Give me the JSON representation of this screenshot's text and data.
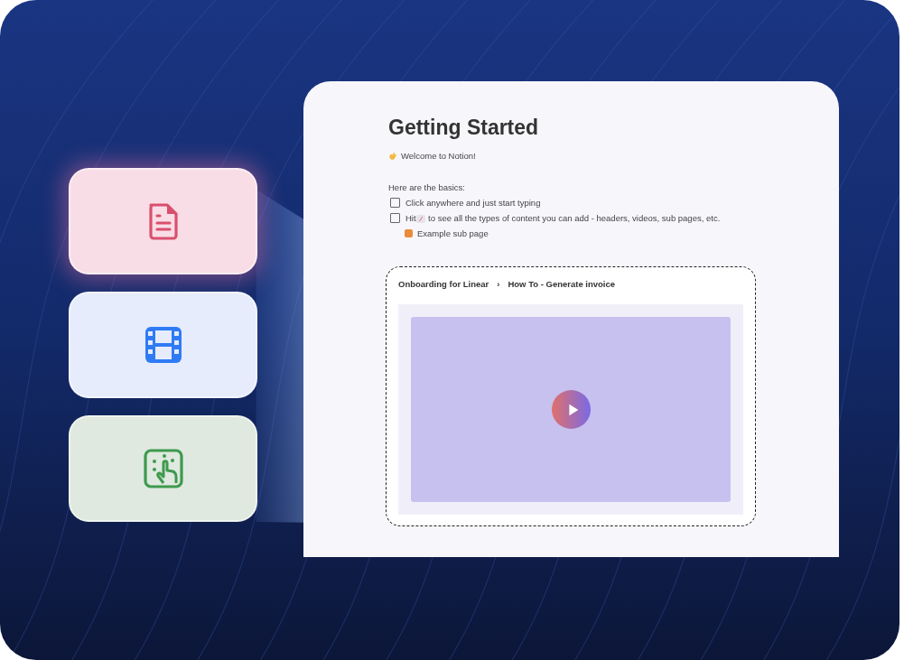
{
  "cards": [
    {
      "kind": "document",
      "color": "#f9dde6",
      "selected": true
    },
    {
      "kind": "video",
      "color": "#e6ecfc",
      "selected": false
    },
    {
      "kind": "interactive",
      "color": "#dfe9df",
      "selected": false
    }
  ],
  "page": {
    "title": "Getting Started",
    "welcome": "Welcome to Notion!",
    "intro": "Here are the basics:",
    "todos": [
      {
        "text": "Click anywhere and just start typing",
        "checked": false
      },
      {
        "text": "Hit",
        "key": "/",
        "after": "to see all the types of content you can add - headers, videos, sub pages, etc.",
        "checked": false
      }
    ],
    "subpage": "Example sub page"
  },
  "embed": {
    "breadcrumb": [
      "Onboarding for Linear",
      "How To - Generate invoice"
    ],
    "separator": "›"
  }
}
